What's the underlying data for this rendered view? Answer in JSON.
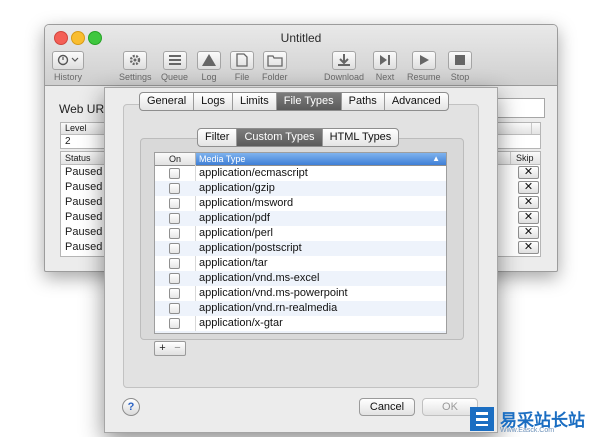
{
  "window": {
    "title": "Untitled",
    "toolbar": [
      {
        "label": "History",
        "icon": "history-icon"
      },
      {
        "label": "Settings",
        "icon": "gear-icon"
      },
      {
        "label": "Queue",
        "icon": "queue-icon"
      },
      {
        "label": "Log",
        "icon": "log-icon"
      },
      {
        "label": "File",
        "icon": "file-icon"
      },
      {
        "label": "Folder",
        "icon": "folder-icon"
      },
      {
        "label": "Download",
        "icon": "download-icon"
      },
      {
        "label": "Next",
        "icon": "next-icon"
      },
      {
        "label": "Resume",
        "icon": "resume-icon"
      },
      {
        "label": "Stop",
        "icon": "stop-icon"
      }
    ],
    "web_url_label": "Web URL:",
    "level_header": "Level",
    "level_value": "2",
    "status_header": "Status",
    "skip_header": "Skip",
    "status_rows": [
      "Paused",
      "Paused",
      "Paused",
      "Paused",
      "Paused",
      "Paused"
    ],
    "skip_glyph": "✕"
  },
  "sheet": {
    "main_tabs": [
      {
        "label": "General",
        "active": false
      },
      {
        "label": "Logs",
        "active": false
      },
      {
        "label": "Limits",
        "active": false
      },
      {
        "label": "File Types",
        "active": true
      },
      {
        "label": "Paths",
        "active": false
      },
      {
        "label": "Advanced",
        "active": false
      }
    ],
    "sub_tabs": [
      {
        "label": "Filter",
        "active": false
      },
      {
        "label": "Custom Types",
        "active": true
      },
      {
        "label": "HTML Types",
        "active": false
      }
    ],
    "table": {
      "col_on": "On",
      "col_type": "Media Type",
      "sort_indicator": "▲",
      "rows": [
        "application/ecmascript",
        "application/gzip",
        "application/msword",
        "application/pdf",
        "application/perl",
        "application/postscript",
        "application/tar",
        "application/vnd.ms-excel",
        "application/vnd.ms-powerpoint",
        "application/vnd.rn-realmedia",
        "application/x-gtar"
      ]
    },
    "add_label": "+",
    "remove_label": "−",
    "help_label": "?",
    "cancel_label": "Cancel",
    "ok_label": "OK"
  },
  "watermark": {
    "text_cn": "易采站长站",
    "text_en": "Www.Easck.Com"
  }
}
